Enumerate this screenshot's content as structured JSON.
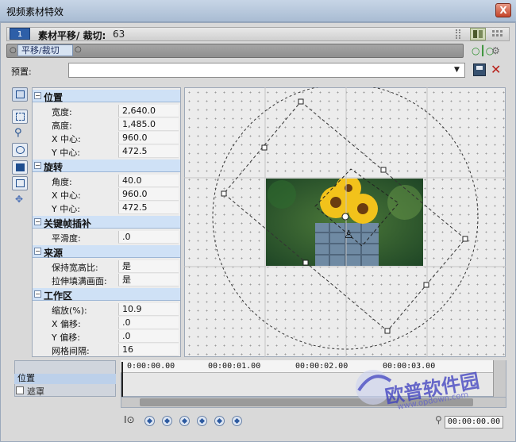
{
  "window": {
    "title": "视频素材特效",
    "close_glyph": "X"
  },
  "header": {
    "media_badge": "1",
    "effect_name": "素材平移/ 裁切:",
    "effect_count": "63"
  },
  "chain": {
    "item_label": "平移/裁切"
  },
  "preset": {
    "label": "预置:",
    "value": ""
  },
  "sections": {
    "position": {
      "title": "位置",
      "rows": [
        {
          "k": "宽度:",
          "v": "2,640.0"
        },
        {
          "k": "高度:",
          "v": "1,485.0"
        },
        {
          "k": "X 中心:",
          "v": "960.0"
        },
        {
          "k": "Y 中心:",
          "v": "472.5"
        }
      ]
    },
    "rotation": {
      "title": "旋转",
      "rows": [
        {
          "k": "角度:",
          "v": "40.0"
        },
        {
          "k": "X 中心:",
          "v": "960.0"
        },
        {
          "k": "Y 中心:",
          "v": "472.5"
        }
      ]
    },
    "keyframe": {
      "title": "关键帧插补",
      "rows": [
        {
          "k": "平滑度:",
          "v": ".0"
        }
      ]
    },
    "source": {
      "title": "来源",
      "rows": [
        {
          "k": "保持宽高比:",
          "v": "是"
        },
        {
          "k": "拉伸填满画面:",
          "v": "是"
        }
      ]
    },
    "workspace": {
      "title": "工作区",
      "rows": [
        {
          "k": "缩放(%):",
          "v": "10.9"
        },
        {
          "k": "X 偏移:",
          "v": ".0"
        },
        {
          "k": "Y 偏移:",
          "v": ".0"
        },
        {
          "k": "网格间隔:",
          "v": "16"
        }
      ]
    }
  },
  "timeline": {
    "tracks": [
      "位置",
      "遮罩"
    ],
    "ruler": [
      "0:00:00.00",
      "00:00:01.00",
      "00:00:02.00",
      "00:00:03.00"
    ],
    "timecode": "00:00:00.00"
  },
  "watermark": {
    "text": "欧普软件园",
    "url": "www.opdown.com"
  },
  "colors": {
    "accent": "#2e5fa8",
    "section_bg": "#cfe1f6",
    "close": "#c4442a"
  }
}
